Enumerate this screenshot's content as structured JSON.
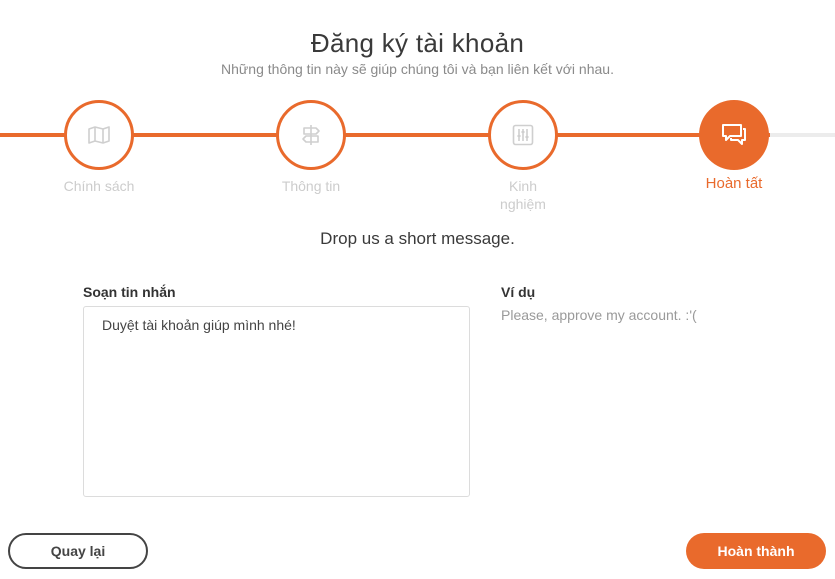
{
  "header": {
    "title": "Đăng ký tài khoản",
    "subtitle": "Những thông tin này sẽ giúp chúng tôi và bạn liên kết với nhau."
  },
  "wizard": {
    "steps": [
      {
        "label": "Chính sách",
        "icon": "map-icon",
        "state": "completed"
      },
      {
        "label": "Thông tin",
        "icon": "signpost-icon",
        "state": "completed"
      },
      {
        "label": "Kinh nghiệm",
        "icon": "sliders-icon",
        "state": "completed"
      },
      {
        "label": "Hoàn tất",
        "icon": "chat-bubbles-icon",
        "state": "active"
      }
    ],
    "accent_color": "#e96a2c"
  },
  "main": {
    "heading": "Drop us a short message.",
    "compose_label": "Soạn tin nhắn",
    "message_value": "Duyệt tài khoản giúp mình nhé!",
    "example_label": "Ví dụ",
    "example_text": "Please, approve my account. :'("
  },
  "footer": {
    "back_label": "Quay lại",
    "finish_label": "Hoàn thành"
  }
}
